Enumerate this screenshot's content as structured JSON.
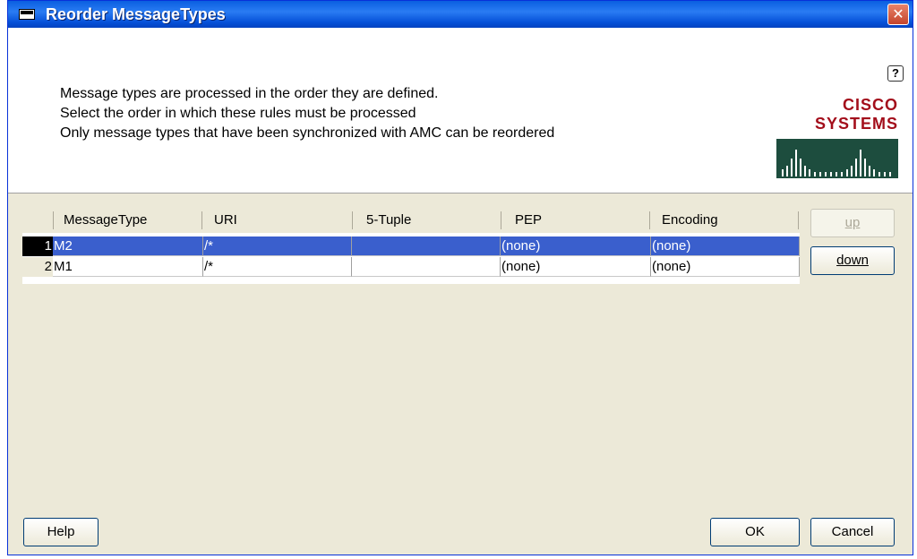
{
  "window": {
    "title": "Reorder MessageTypes",
    "close_label": "✕"
  },
  "header": {
    "help_icon_label": "?",
    "description_lines": [
      "Message types are processed in the order they are defined.",
      "Select the order in which these rules must be processed",
      "Only message types that have been synchronized with AMC can be reordered"
    ],
    "logo_text": "CISCO SYSTEMS",
    "logo_color": "#a30e1b"
  },
  "table": {
    "columns": [
      "MessageType",
      "URI",
      "5-Tuple",
      "PEP",
      "Encoding"
    ],
    "rows": [
      {
        "num": "1",
        "message_type": "M2",
        "uri": "/*",
        "five_tuple": "",
        "pep": "(none)",
        "encoding": "(none)",
        "selected": true
      },
      {
        "num": "2",
        "message_type": "M1",
        "uri": "/*",
        "five_tuple": "",
        "pep": "(none)",
        "encoding": "(none)",
        "selected": false
      }
    ],
    "selection_color": "#3a5fcd"
  },
  "buttons": {
    "up": "up",
    "down": "down",
    "help": "Help",
    "ok": "OK",
    "cancel": "Cancel"
  }
}
